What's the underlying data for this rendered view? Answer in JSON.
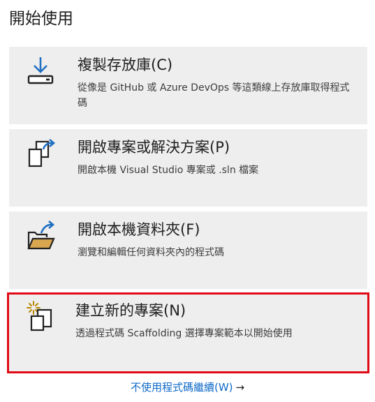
{
  "heading": "開始使用",
  "cards": [
    {
      "title": "複製存放庫(C)",
      "description": "從像是 GitHub 或 Azure DevOps 等這類線上存放庫取得程式碼",
      "icon": "download-drive-icon"
    },
    {
      "title": "開啟專案或解決方案(P)",
      "description": "開啟本機 Visual Studio 專案或 .sln 檔案",
      "icon": "open-project-icon"
    },
    {
      "title": "開啟本機資料夾(F)",
      "description": "瀏覽和編輯任何資料夾內的程式碼",
      "icon": "open-folder-icon"
    },
    {
      "title": "建立新的專案(N)",
      "description": "透過程式碼 Scaffolding 選擇專案範本以開始使用",
      "icon": "new-project-icon"
    }
  ],
  "continue_link": {
    "label": "不使用程式碼繼續(W)",
    "arrow": "→"
  },
  "colors": {
    "card_background": "#efeeee",
    "highlight_border": "#e00a16",
    "link": "#0e6ac8",
    "icon_blue": "#1f6fc2",
    "icon_dark": "#212121",
    "folder_tan": "#d9a750",
    "spark_gold": "#b58600"
  }
}
